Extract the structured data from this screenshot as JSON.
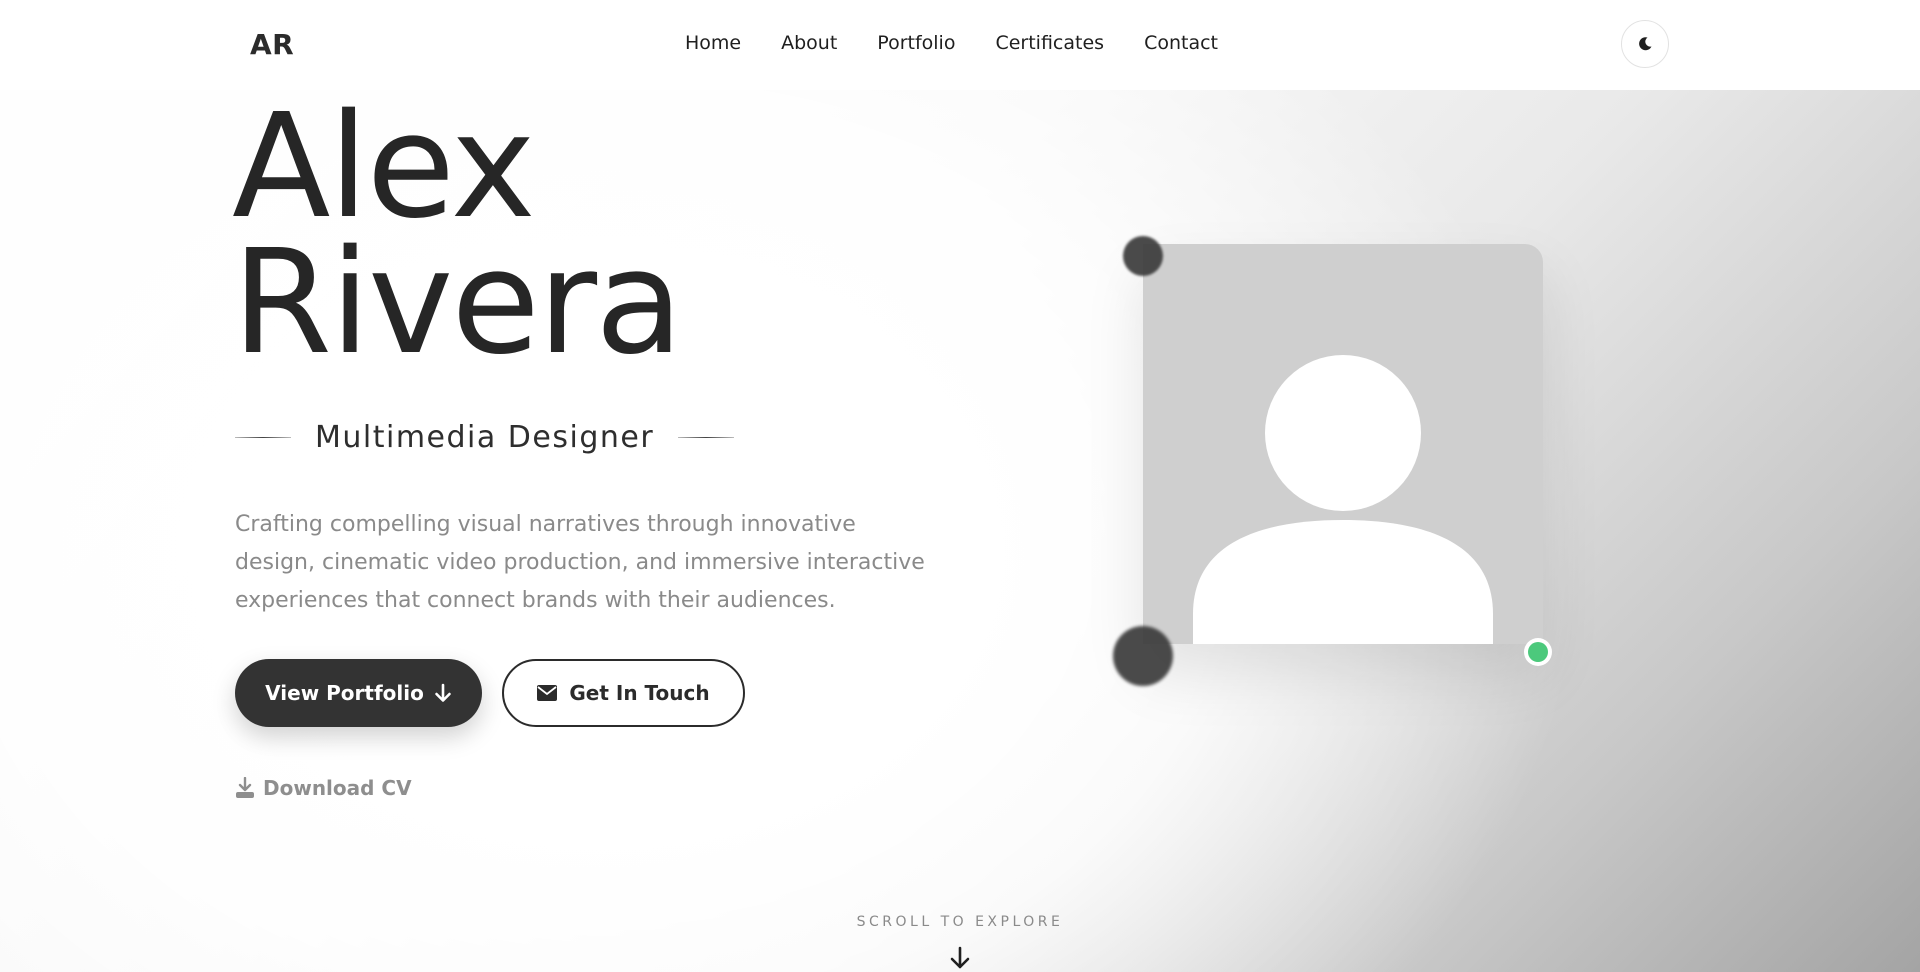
{
  "header": {
    "logo": "AR",
    "nav": [
      {
        "label": "Home"
      },
      {
        "label": "About"
      },
      {
        "label": "Portfolio"
      },
      {
        "label": "Certificates"
      },
      {
        "label": "Contact"
      }
    ],
    "theme_toggle_icon": "moon-icon"
  },
  "hero": {
    "first_name": "Alex",
    "last_name": "Rivera",
    "role": "Multimedia Designer",
    "description": "Crafting compelling visual narratives through innovative design, cinematic video production, and immersive interactive experiences that connect brands with their audiences.",
    "primary_button": {
      "label": "View Portfolio",
      "icon": "arrow-down-icon"
    },
    "secondary_button": {
      "label": "Get In Touch",
      "icon": "envelope-icon"
    },
    "download_link": {
      "label": "Download CV",
      "icon": "download-icon"
    },
    "profile_image_icon": "user-avatar-icon",
    "status_color": "#4cc97c"
  },
  "scroll_hint": {
    "label": "SCROLL TO EXPLORE",
    "icon": "arrow-down-icon"
  },
  "colors": {
    "text_dark": "#2b2b2b",
    "text_muted": "#8a8a8a",
    "button_dark": "#333333",
    "placeholder_gray": "#cfcfcf"
  }
}
